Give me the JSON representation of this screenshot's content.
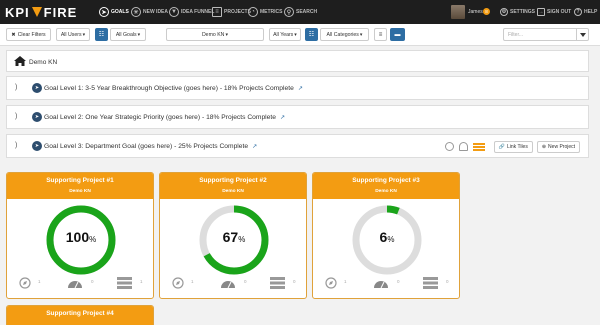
{
  "app": {
    "logo_text_left": "KPI",
    "logo_text_right": "FIRE"
  },
  "nav": {
    "items": [
      {
        "label": "GOALS",
        "icon": "compass-icon"
      },
      {
        "label": "NEW IDEA",
        "icon": "lightbulb-icon"
      },
      {
        "label": "IDEA FUNNEL",
        "icon": "funnel-icon"
      },
      {
        "label": "PROJECTS",
        "icon": "projects-icon"
      },
      {
        "label": "METRICS",
        "icon": "gauge-icon"
      },
      {
        "label": "SEARCH",
        "icon": "search-icon"
      }
    ],
    "user_name": "James",
    "notification_count": "8",
    "settings_label": "SETTINGS",
    "signout_label": "SIGN OUT",
    "help_label": "HELP"
  },
  "filters": {
    "clear_label": "Clear Filters",
    "users_label": "All Users",
    "goals_label": "All Goals",
    "org_label": "Demo KN",
    "years_label": "All Years",
    "categories_label": "All Categories",
    "filter_placeholder": "Filter..."
  },
  "header": {
    "title": "Demo KN"
  },
  "goals": [
    {
      "text": "Goal Level 1: 3-5 Year Breakthrough Objective (goes here) - 18% Projects Complete"
    },
    {
      "text": "Goal Level 2: One Year Strategic Priority (goes here) - 18% Projects Complete"
    },
    {
      "text": "Goal Level 3: Department Goal (goes here) - 25% Projects Complete"
    }
  ],
  "goal_actions": {
    "link_tiles_label": "Link Tiles",
    "new_project_label": "New Project"
  },
  "projects": [
    {
      "title": "Supporting Project #1",
      "org": "Demo KN",
      "progress": 100,
      "progress_label": "100",
      "ideas": "1",
      "metrics": "0",
      "tasks": "1"
    },
    {
      "title": "Supporting Project #2",
      "org": "Demo KN",
      "progress": 67,
      "progress_label": "67",
      "ideas": "1",
      "metrics": "0",
      "tasks": "0"
    },
    {
      "title": "Supporting Project #3",
      "org": "Demo KN",
      "progress": 6,
      "progress_label": "6",
      "ideas": "1",
      "metrics": "0",
      "tasks": "0"
    },
    {
      "title": "Supporting Project #4",
      "org": "",
      "progress": null,
      "progress_label": "",
      "ideas": "",
      "metrics": "",
      "tasks": ""
    }
  ],
  "percent_symbol": "%",
  "colors": {
    "nav_bg": "#1e1e1e",
    "accent_orange": "#f39c12",
    "primary_blue": "#2d6da3",
    "progress_green": "#1aa41a",
    "ring_gray": "#dddddd"
  }
}
